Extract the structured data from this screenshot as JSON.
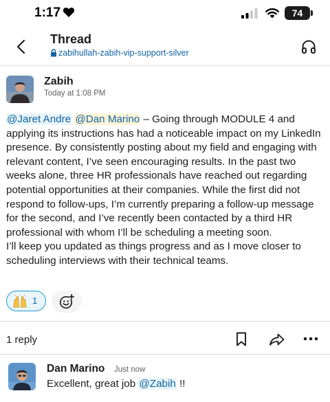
{
  "status_bar": {
    "time": "1:17",
    "battery": "74"
  },
  "header": {
    "title": "Thread",
    "channel": "zabihullah-zabih-vip-support-silver"
  },
  "message": {
    "author": "Zabih",
    "timestamp": "Today at 1:08 PM",
    "mention_1": "@Jaret Andre",
    "mention_2": "@Dan Marino",
    "text_1": " – Going through MODULE 4 and applying its instructions has had a noticeable impact on my LinkedIn presence. By consistently posting about my field and engaging with relevant content, I’ve seen encouraging results. In the past two weeks alone, three HR professionals have reached out regarding potential opportunities at their companies. While the first did not respond to follow-ups, I’m currently preparing a follow-up message for the second, and I’ve recently been contacted by a third HR professional with whom I’ll be scheduling a meeting soon.",
    "text_2": "I’ll keep you updated as things progress and as I move closer to scheduling interviews with their technical teams."
  },
  "reactions": [
    {
      "icon": "raised-hands-icon",
      "count": "1"
    }
  ],
  "thread_footer": {
    "reply_count": "1 reply"
  },
  "reply": {
    "author": "Dan Marino",
    "time": "Just now",
    "text_before": "Excellent, great job ",
    "mention": "@Zabih",
    "text_after": " !!"
  },
  "colors": {
    "link": "#1264a3",
    "reaction_border": "#1d9bd1",
    "text": "#1d1c1d",
    "muted": "#616061"
  }
}
